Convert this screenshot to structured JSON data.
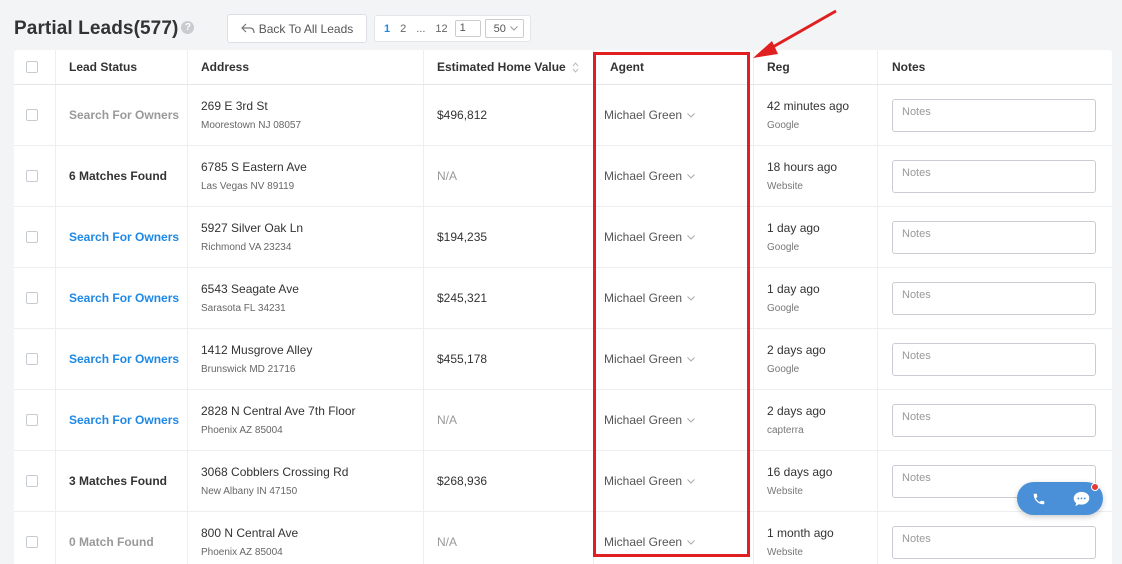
{
  "header": {
    "title": "Partial Leads(577)",
    "help_icon": "question-circle-icon",
    "back_label": "Back To All Leads",
    "back_icon": "reply-arrow-icon"
  },
  "pagination": {
    "pages": [
      "1",
      "2",
      "...",
      "12"
    ],
    "current_page": "1",
    "jump_value": "1",
    "page_size": "50"
  },
  "table": {
    "columns": {
      "status": "Lead Status",
      "address": "Address",
      "value": "Estimated Home Value",
      "agent": "Agent",
      "reg": "Reg",
      "notes": "Notes"
    },
    "rows": [
      {
        "status": "Search For Owners",
        "status_style": "gray",
        "address": "269 E 3rd St",
        "city": "Moorestown NJ 08057",
        "value": "$496,812",
        "agent": "Michael Green",
        "reg_time": "42 minutes ago",
        "reg_source": "Google",
        "notes_placeholder": "Notes"
      },
      {
        "status": "6 Matches Found",
        "status_style": "dark",
        "address": "6785 S Eastern Ave",
        "city": "Las Vegas NV 89119",
        "value": "N/A",
        "agent": "Michael Green",
        "reg_time": "18 hours ago",
        "reg_source": "Website",
        "notes_placeholder": "Notes"
      },
      {
        "status": "Search For Owners",
        "status_style": "blue",
        "address": "5927 Silver Oak Ln",
        "city": "Richmond VA 23234",
        "value": "$194,235",
        "agent": "Michael Green",
        "reg_time": "1 day ago",
        "reg_source": "Google",
        "notes_placeholder": "Notes"
      },
      {
        "status": "Search For Owners",
        "status_style": "blue",
        "address": "6543 Seagate Ave",
        "city": "Sarasota FL 34231",
        "value": "$245,321",
        "agent": "Michael Green",
        "reg_time": "1 day ago",
        "reg_source": "Google",
        "notes_placeholder": "Notes"
      },
      {
        "status": "Search For Owners",
        "status_style": "blue",
        "address": "1412 Musgrove Alley",
        "city": "Brunswick MD 21716",
        "value": "$455,178",
        "agent": "Michael Green",
        "reg_time": "2 days ago",
        "reg_source": "Google",
        "notes_placeholder": "Notes"
      },
      {
        "status": "Search For Owners",
        "status_style": "blue",
        "address": "2828 N Central Ave 7th Floor",
        "city": "Phoenix AZ 85004",
        "value": "N/A",
        "agent": "Michael Green",
        "reg_time": "2 days ago",
        "reg_source": "capterra",
        "notes_placeholder": "Notes"
      },
      {
        "status": "3 Matches Found",
        "status_style": "dark",
        "address": "3068 Cobblers Crossing Rd",
        "city": "New Albany IN 47150",
        "value": "$268,936",
        "agent": "Michael Green",
        "reg_time": "16 days ago",
        "reg_source": "Website",
        "notes_placeholder": "Notes"
      },
      {
        "status": "0 Match Found",
        "status_style": "gray",
        "address": "800 N Central Ave",
        "city": "Phoenix AZ 85004",
        "value": "N/A",
        "agent": "Michael Green",
        "reg_time": "1 month ago",
        "reg_source": "Website",
        "notes_placeholder": "Notes"
      }
    ]
  },
  "annotation": {
    "highlight_color": "#e02020"
  },
  "float_widget": {
    "icons": [
      "phone-icon",
      "chat-bubble-icon"
    ],
    "color": "#4a90d9"
  }
}
